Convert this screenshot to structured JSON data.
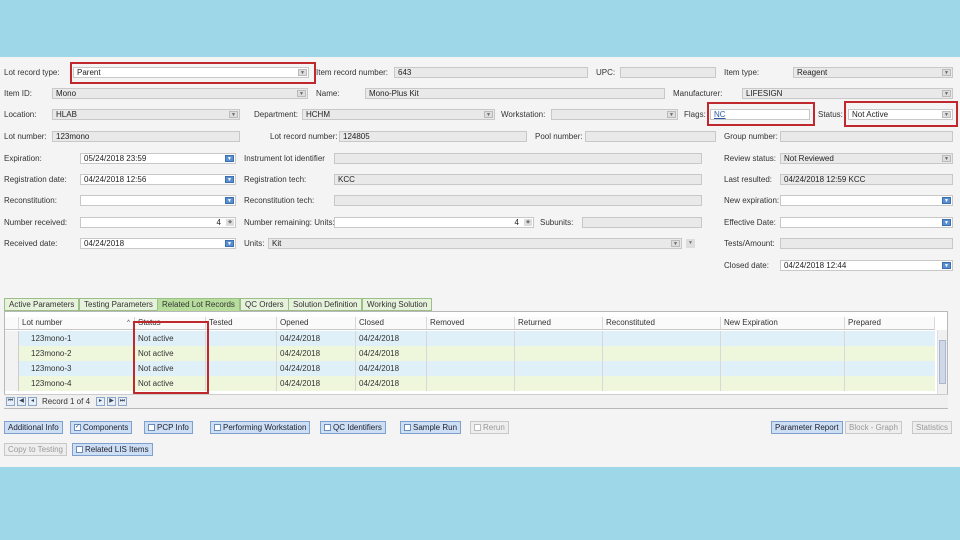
{
  "form": {
    "lot_record_type": {
      "label": "Lot record type:",
      "value": "Parent"
    },
    "item_record_number": {
      "label": "Item record number:",
      "value": "643"
    },
    "upc": {
      "label": "UPC:",
      "value": ""
    },
    "item_type": {
      "label": "Item type:",
      "value": "Reagent"
    },
    "item_id": {
      "label": "Item ID:",
      "value": "Mono"
    },
    "name": {
      "label": "Name:",
      "value": "Mono-Plus Kit"
    },
    "manufacturer": {
      "label": "Manufacturer:",
      "value": "LIFESIGN"
    },
    "location": {
      "label": "Location:",
      "value": "HLAB"
    },
    "department": {
      "label": "Department:",
      "value": "HCHM"
    },
    "workstation": {
      "label": "Workstation:",
      "value": ""
    },
    "flags": {
      "label": "Flags:",
      "value": "NC"
    },
    "status": {
      "label": "Status:",
      "value": "Not Active"
    },
    "lot_number": {
      "label": "Lot number:",
      "value": "123mono"
    },
    "lot_record_number": {
      "label": "Lot record number:",
      "value": "124805"
    },
    "pool_number": {
      "label": "Pool number:",
      "value": ""
    },
    "group_number": {
      "label": "Group number:",
      "value": ""
    },
    "expiration": {
      "label": "Expiration:",
      "value": "05/24/2018 23:59"
    },
    "instrument_lot_identifier": {
      "label": "Instrument lot identifier",
      "value": ""
    },
    "review_status": {
      "label": "Review status:",
      "value": "Not Reviewed"
    },
    "registration_date": {
      "label": "Registration date:",
      "value": "04/24/2018 12:56"
    },
    "registration_tech": {
      "label": "Registration tech:",
      "value": "KCC"
    },
    "last_resulted": {
      "label": "Last resulted:",
      "value": "04/24/2018 12:59 KCC"
    },
    "reconstitution": {
      "label": "Reconstitution:",
      "value": ""
    },
    "reconstitution_tech": {
      "label": "Reconstitution tech:",
      "value": ""
    },
    "new_expiration": {
      "label": "New expiration:",
      "value": ""
    },
    "number_received": {
      "label": "Number received:",
      "value": "4"
    },
    "number_remaining": {
      "label": "Number remaining: Units:",
      "value": "4"
    },
    "subunits": {
      "label": "Subunits:",
      "value": ""
    },
    "effective_date": {
      "label": "Effective Date:",
      "value": ""
    },
    "received_date": {
      "label": "Received date:",
      "value": "04/24/2018"
    },
    "units": {
      "label": "Units:",
      "value": "Kit"
    },
    "tests_amount": {
      "label": "Tests/Amount:",
      "value": ""
    },
    "closed_date": {
      "label": "Closed date:",
      "value": "04/24/2018 12:44"
    }
  },
  "tabs": [
    "Active Parameters",
    "Testing Parameters",
    "Related Lot Records",
    "QC Orders",
    "Solution Definition",
    "Working Solution"
  ],
  "active_tab": "Related Lot Records",
  "grid": {
    "columns": [
      "Lot number",
      "Status",
      "Tested",
      "Opened",
      "Closed",
      "Removed",
      "Returned",
      "Reconstituted",
      "New Expiration",
      "Prepared"
    ],
    "sort_indicator": "^",
    "rows": [
      {
        "lot": "123mono-1",
        "status": "Not active",
        "tested": "",
        "opened": "04/24/2018",
        "closed": "04/24/2018"
      },
      {
        "lot": "123mono-2",
        "status": "Not active",
        "tested": "",
        "opened": "04/24/2018",
        "closed": "04/24/2018"
      },
      {
        "lot": "123mono-3",
        "status": "Not active",
        "tested": "",
        "opened": "04/24/2018",
        "closed": "04/24/2018"
      },
      {
        "lot": "123mono-4",
        "status": "Not active",
        "tested": "",
        "opened": "04/24/2018",
        "closed": "04/24/2018"
      }
    ],
    "pager_text": "Record 1 of 4"
  },
  "buttons": {
    "additional_info": "Additional Info",
    "components": "Components",
    "pcp_info": "PCP Info",
    "performing_workstation": "Performing Workstation",
    "qc_identifiers": "QC Identifiers",
    "sample_run": "Sample Run",
    "rerun": "Rerun",
    "parameter_report": "Parameter Report",
    "block_graph": "Block - Graph",
    "statistics": "Statistics",
    "copy_to_testing": "Copy to Testing",
    "related_lis_items": "Related LIS Items"
  }
}
